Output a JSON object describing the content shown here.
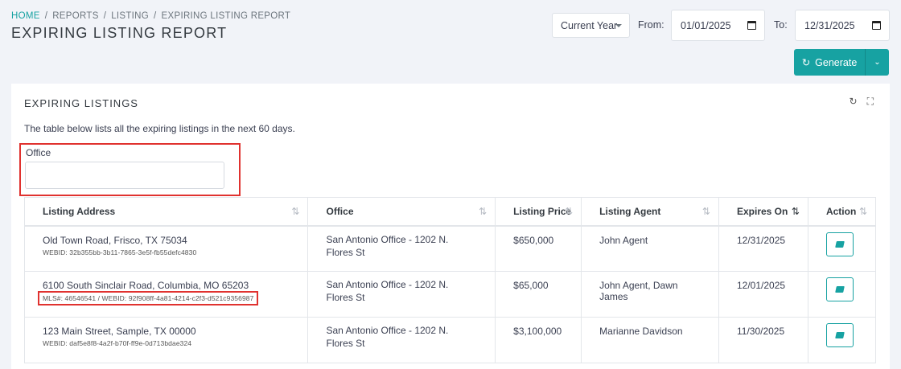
{
  "breadcrumb": [
    "HOME",
    "REPORTS",
    "LISTING",
    "EXPIRING LISTING REPORT"
  ],
  "page_title": "EXPIRING LISTING REPORT",
  "toolbar": {
    "period": "Current Year",
    "from_label": "From:",
    "from_value": "01/01/2025",
    "to_label": "To:",
    "to_value": "12/31/2025",
    "generate_label": "Generate"
  },
  "card": {
    "title": "EXPIRING LISTINGS",
    "description": "The table below lists all the expiring listings in the next 60 days.",
    "office_label": "Office",
    "office_value": ""
  },
  "table": {
    "columns": [
      "Listing Address",
      "Office",
      "Listing Price",
      "Listing Agent",
      "Expires On",
      "Action"
    ],
    "rows": [
      {
        "address": "Old Town Road, Frisco, TX 75034",
        "sub": "WEBID: 32b355bb-3b11-7865-3e5f-fb55defc4830",
        "office": "San Antonio Office - 1202 N. Flores St",
        "price": "$650,000",
        "agent": "John Agent",
        "expires": "12/31/2025"
      },
      {
        "address": "6100 South Sinclair Road, Columbia, MO 65203",
        "sub": "MLS#: 46546541 / WEBID: 92f908ff-4a81-4214-c2f3-d521c9356987",
        "office": "San Antonio Office - 1202 N. Flores St",
        "price": "$65,000",
        "agent": "John Agent, Dawn James",
        "expires": "12/01/2025"
      },
      {
        "address": "123 Main Street, Sample, TX 00000",
        "sub": "WEBID: daf5e8f8-4a2f-b70f-ff9e-0d713bdae324",
        "office": "San Antonio Office - 1202 N. Flores St",
        "price": "$3,100,000",
        "agent": "Marianne Davidson",
        "expires": "11/30/2025"
      }
    ]
  },
  "colors": {
    "accent": "#17a2a2",
    "highlight": "#e0322f"
  }
}
